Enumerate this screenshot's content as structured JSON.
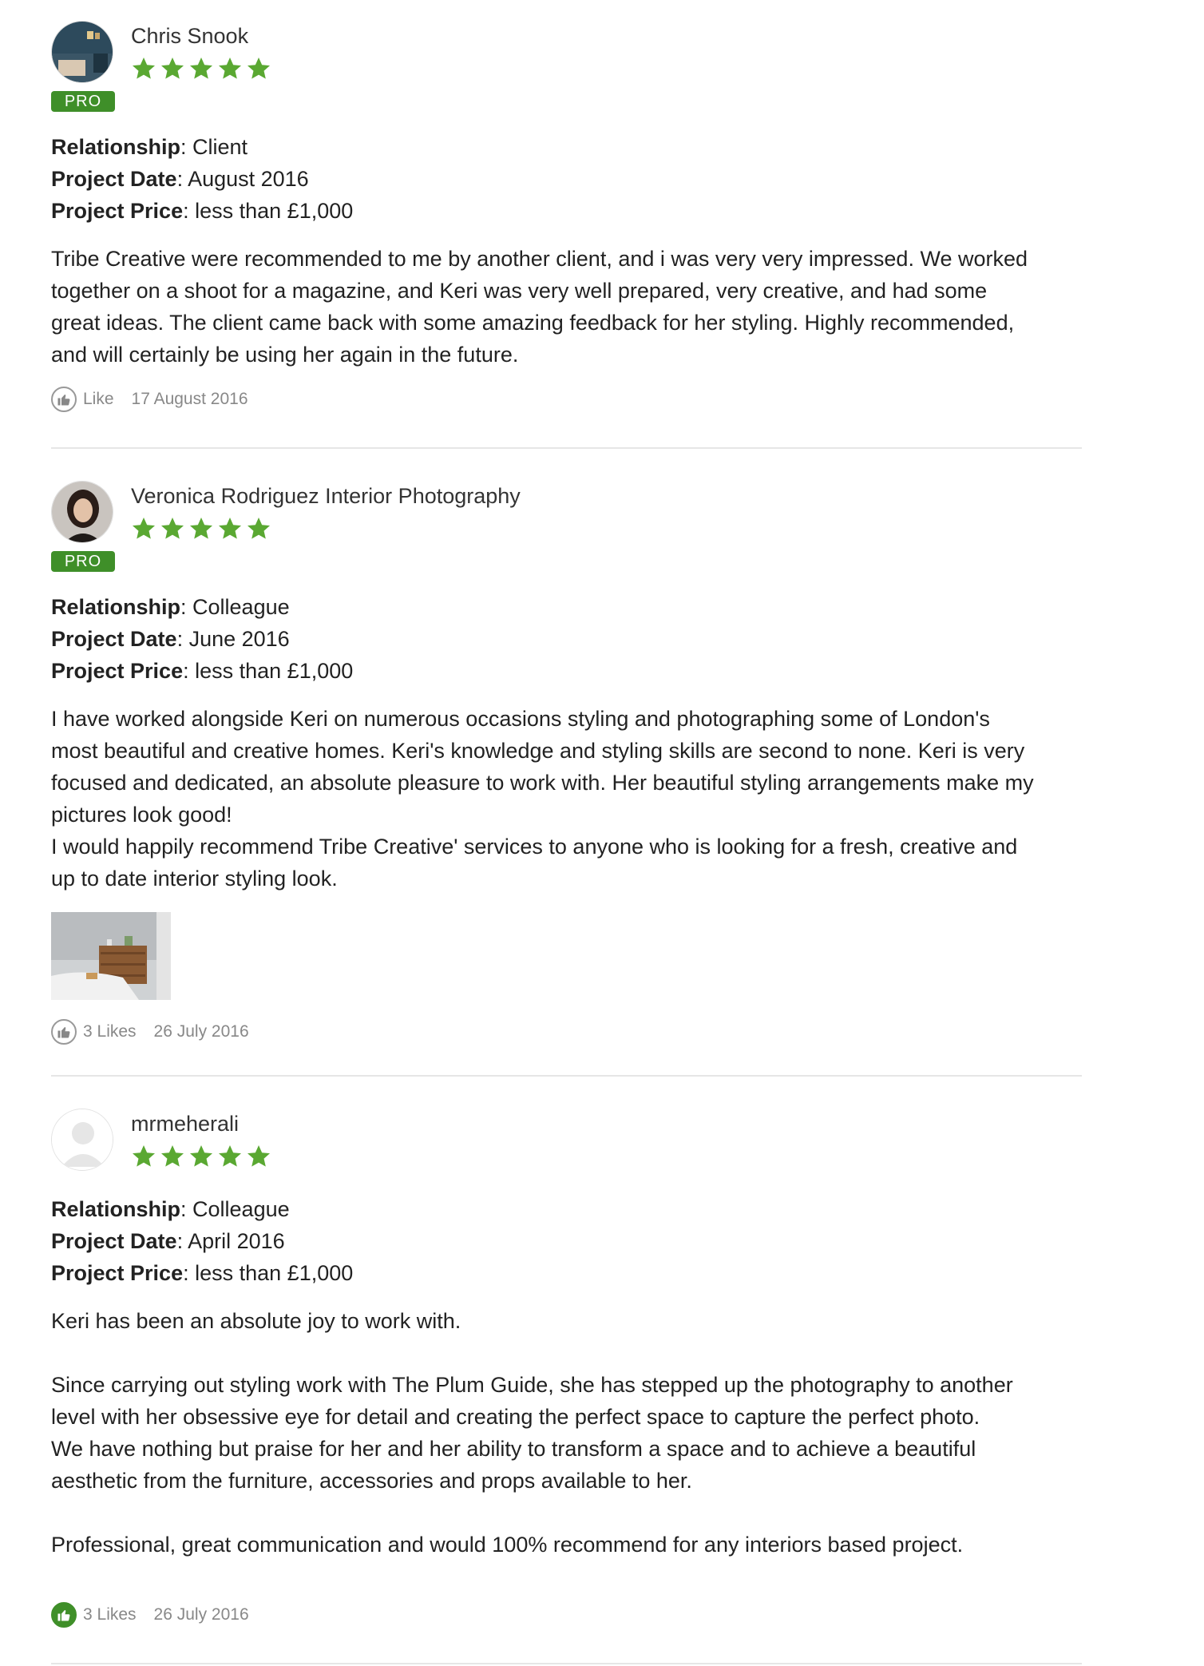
{
  "colors": {
    "accent": "#3f8f29",
    "star": "#5aa832"
  },
  "labels": {
    "relationship": "Relationship",
    "project_date": "Project Date",
    "project_price": "Project Price"
  },
  "reviews": [
    {
      "name": "Chris Snook",
      "rating": 5,
      "badge": "PRO",
      "relationship": "Client",
      "project_date": "August 2016",
      "project_price": "less than £1,000",
      "text": "Tribe Creative were recommended to me by another client, and i was very very impressed. We worked together on a shoot for a magazine, and Keri was very well prepared, very creative, and had some great ideas. The client came back with some amazing feedback for her styling. Highly recommended, and will certainly be using her again in the future.",
      "likes": "Like",
      "date": "17 August 2016",
      "liked": false
    },
    {
      "name": "Veronica Rodriguez Interior Photography",
      "rating": 5,
      "badge": "PRO",
      "relationship": "Colleague",
      "project_date": "June 2016",
      "project_price": "less than £1,000",
      "text": "I have worked alongside Keri on numerous occasions styling and photographing some of London's most beautiful and creative homes. Keri's knowledge and styling skills are second to none. Keri is very focused and dedicated, an absolute pleasure to work with. Her beautiful styling arrangements make my pictures look good!\nI would happily recommend Tribe Creative' services to anyone who is looking for a fresh, creative and up to date interior styling look.",
      "likes": "3 Likes",
      "date": "26 July 2016",
      "liked": false
    },
    {
      "name": "mrmeherali",
      "rating": 5,
      "relationship": "Colleague",
      "project_date": "April 2016",
      "project_price": "less than £1,000",
      "text": "Keri has been an absolute joy to work with.\n\nSince carrying out styling work with The Plum Guide, she has stepped up the photography to another level with her obsessive eye for detail and creating the perfect space to capture the perfect photo.\nWe have nothing but praise for her and her ability to transform a space and to achieve a beautiful aesthetic from the furniture, accessories and props available to her.\n\nProfessional, great communication and would 100% recommend for any interiors based project.",
      "likes": "3 Likes",
      "date": "26 July 2016",
      "liked": true
    }
  ]
}
